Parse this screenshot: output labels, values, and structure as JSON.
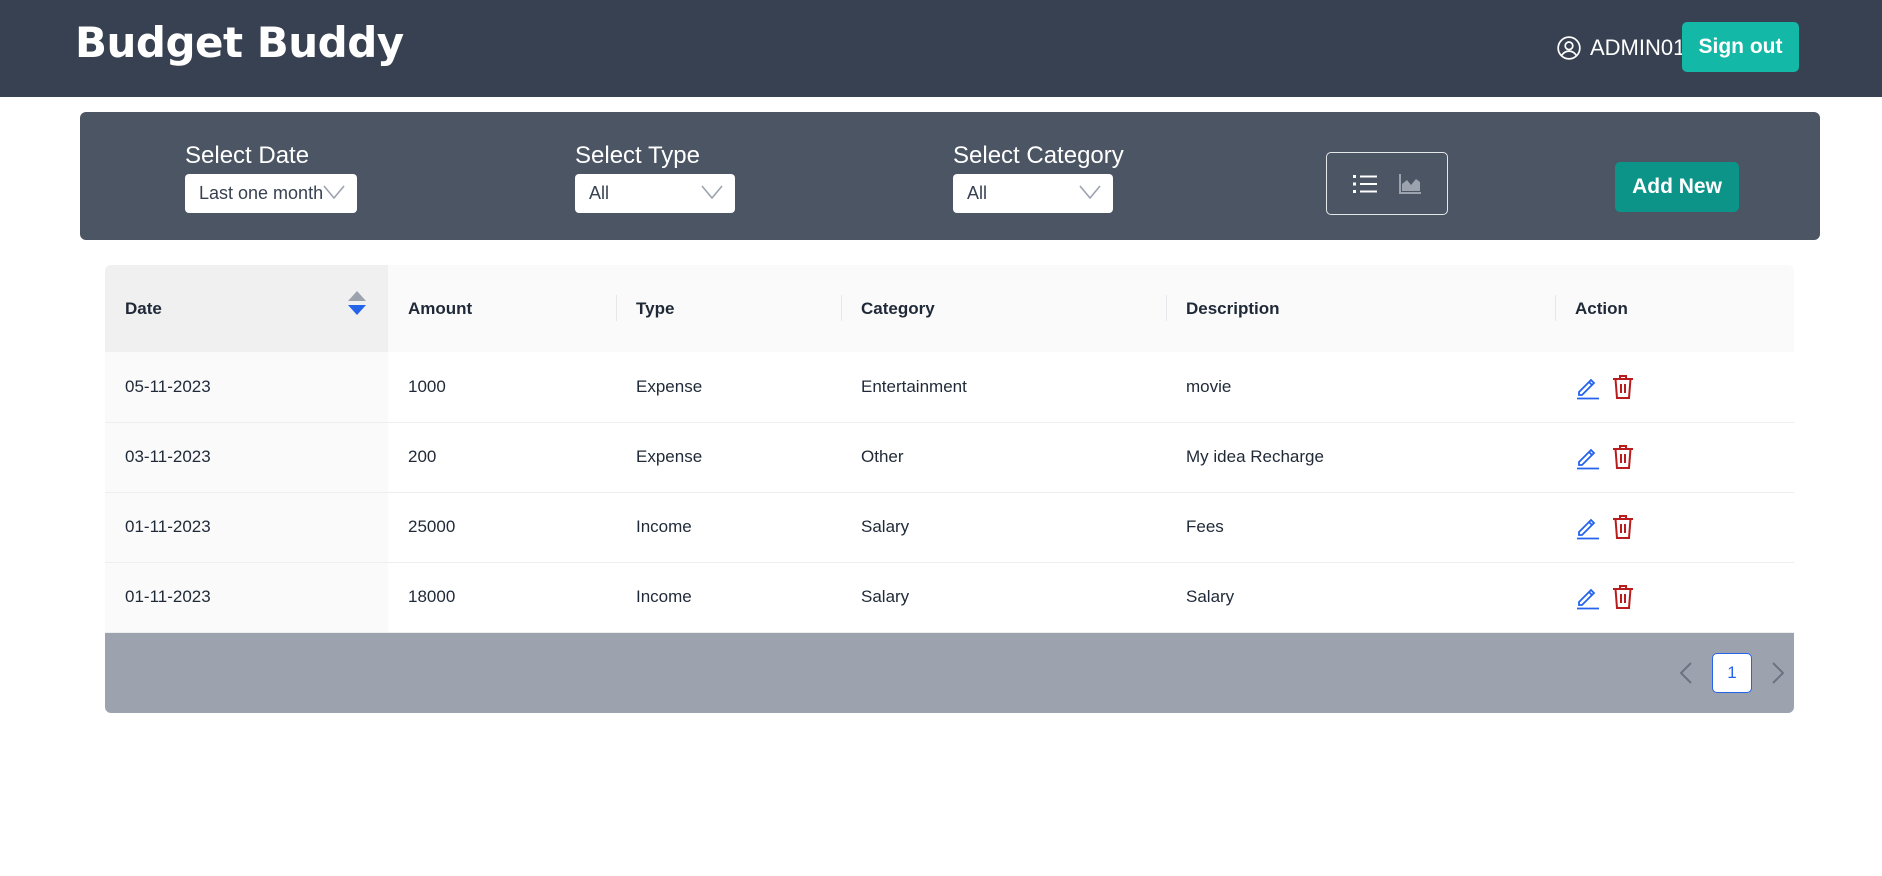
{
  "header": {
    "brand": "Budget Buddy",
    "user_icon": "user-circle-icon",
    "username": "ADMIN01",
    "signout_label": "Sign out"
  },
  "filters": {
    "date": {
      "label": "Select Date",
      "value": "Last one month"
    },
    "type": {
      "label": "Select Type",
      "value": "All"
    },
    "category": {
      "label": "Select Category",
      "value": "All"
    },
    "view_icons": [
      "list-view-icon",
      "chart-view-icon"
    ],
    "add_new_label": "Add New"
  },
  "table": {
    "columns": [
      "Date",
      "Amount",
      "Type",
      "Category",
      "Description",
      "Action"
    ],
    "rows": [
      {
        "date": "05-11-2023",
        "amount": "1000",
        "type": "Expense",
        "category": "Entertainment",
        "description": "movie"
      },
      {
        "date": "03-11-2023",
        "amount": "200",
        "type": "Expense",
        "category": "Other",
        "description": "My idea Recharge"
      },
      {
        "date": "01-11-2023",
        "amount": "25000",
        "type": "Income",
        "category": "Salary",
        "description": "Fees"
      },
      {
        "date": "01-11-2023",
        "amount": "18000",
        "type": "Income",
        "category": "Salary",
        "description": "Salary"
      }
    ],
    "action_icons": [
      "edit-icon",
      "delete-icon"
    ]
  },
  "pagination": {
    "current_page": "1"
  },
  "colors": {
    "header_bg": "#374151",
    "filter_bg": "#4b5563",
    "signout": "#14b8a6",
    "add_new": "#0d9488",
    "edit": "#2563eb",
    "delete": "#b91c1c",
    "pager_bg": "#9ca3af"
  }
}
